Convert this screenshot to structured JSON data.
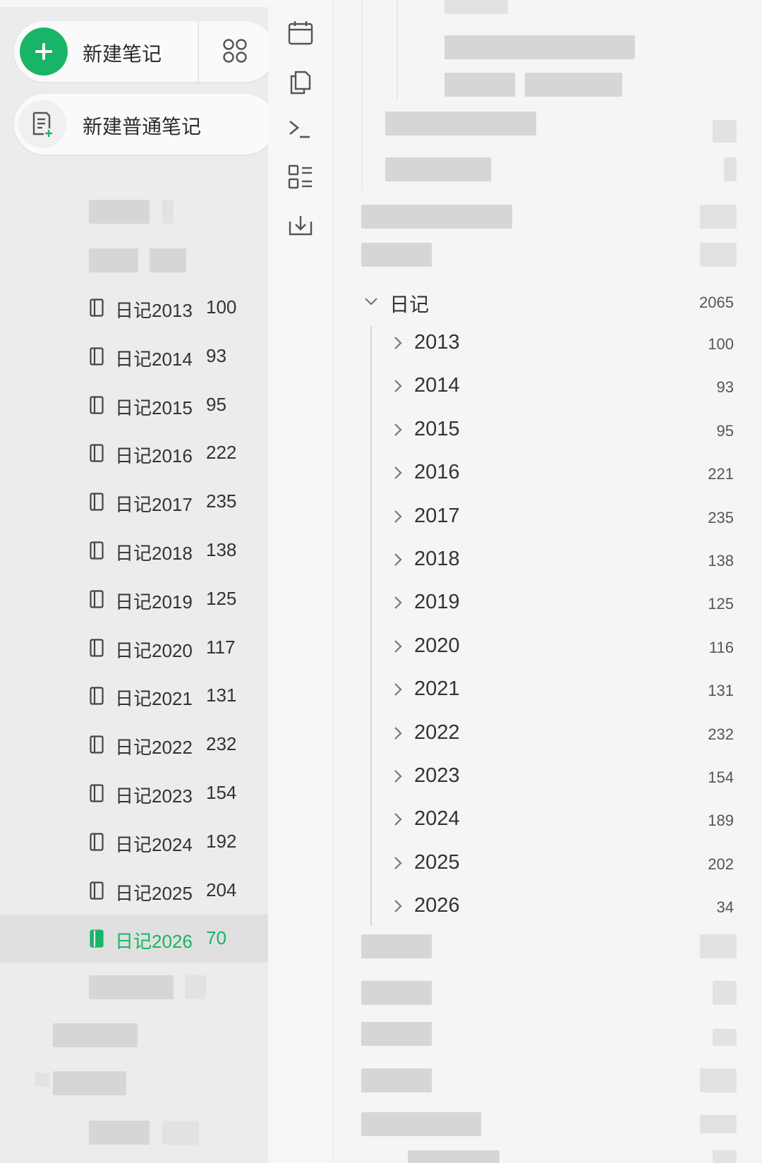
{
  "sidebar": {
    "new_note_label": "新建笔记",
    "new_plain_note_label": "新建普通笔记",
    "notebooks": [
      {
        "name": "日记2013",
        "count": "100",
        "selected": false
      },
      {
        "name": "日记2014",
        "count": "93",
        "selected": false
      },
      {
        "name": "日记2015",
        "count": "95",
        "selected": false
      },
      {
        "name": "日记2016",
        "count": "222",
        "selected": false
      },
      {
        "name": "日记2017",
        "count": "235",
        "selected": false
      },
      {
        "name": "日记2018",
        "count": "138",
        "selected": false
      },
      {
        "name": "日记2019",
        "count": "125",
        "selected": false
      },
      {
        "name": "日记2020",
        "count": "117",
        "selected": false
      },
      {
        "name": "日记2021",
        "count": "131",
        "selected": false
      },
      {
        "name": "日记2022",
        "count": "232",
        "selected": false
      },
      {
        "name": "日记2023",
        "count": "154",
        "selected": false
      },
      {
        "name": "日记2024",
        "count": "192",
        "selected": false
      },
      {
        "name": "日记2025",
        "count": "204",
        "selected": false
      },
      {
        "name": "日记2026",
        "count": "70",
        "selected": true
      }
    ]
  },
  "toolbar": {
    "icons": [
      "calendar-icon",
      "copy-icon",
      "terminal-icon",
      "list-view-icon",
      "download-icon"
    ]
  },
  "outline": {
    "diary_label": "日记",
    "diary_count": "2065",
    "years": [
      {
        "year": "2013",
        "count": "100"
      },
      {
        "year": "2014",
        "count": "93"
      },
      {
        "year": "2015",
        "count": "95"
      },
      {
        "year": "2016",
        "count": "221"
      },
      {
        "year": "2017",
        "count": "235"
      },
      {
        "year": "2018",
        "count": "138"
      },
      {
        "year": "2019",
        "count": "125"
      },
      {
        "year": "2020",
        "count": "116"
      },
      {
        "year": "2021",
        "count": "131"
      },
      {
        "year": "2022",
        "count": "232"
      },
      {
        "year": "2023",
        "count": "154"
      },
      {
        "year": "2024",
        "count": "189"
      },
      {
        "year": "2025",
        "count": "202"
      },
      {
        "year": "2026",
        "count": "34"
      }
    ]
  },
  "colors": {
    "accent": "#18b566",
    "sidebar_bg": "#ececec",
    "selected_row_bg": "#e0e0e0"
  }
}
